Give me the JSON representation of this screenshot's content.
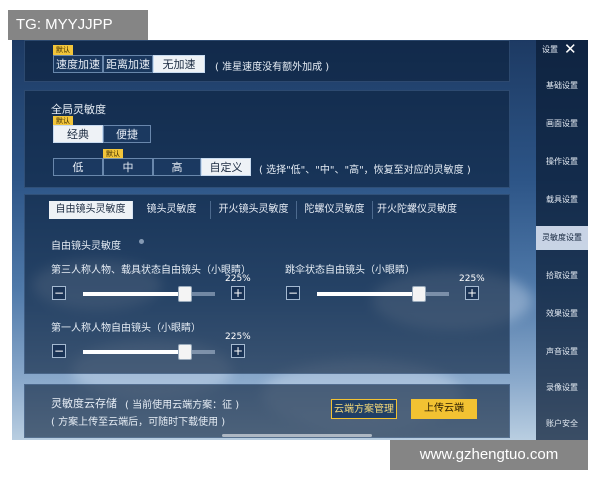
{
  "overlay": {
    "tag": "TG: MYYJJPP",
    "watermark": "www.gzhengtuo.com"
  },
  "speed_panel": {
    "badge": "默认",
    "options": [
      "速度加速",
      "距离加速",
      "无加速"
    ],
    "selected": "无加速",
    "note": "( 准星速度没有额外加成 )"
  },
  "global_sensitivity": {
    "title": "全局灵敏度",
    "badge_mode": "默认",
    "modes": [
      "经典",
      "便捷"
    ],
    "selected_mode": "经典",
    "badge_level": "默认",
    "levels": [
      "低",
      "中",
      "高",
      "自定义"
    ],
    "selected_level": "自定义",
    "note": "( 选择\"低\"、\"中\"、\"高\"，恢复至对应的灵敏度 )"
  },
  "sensitivity_tabs": {
    "tabs": [
      "自由镜头灵敏度",
      "镜头灵敏度",
      "开火镜头灵敏度",
      "陀螺仪灵敏度",
      "开火陀螺仪灵敏度"
    ],
    "selected": "自由镜头灵敏度"
  },
  "free_camera": {
    "section_title": "自由镜头灵敏度",
    "sliders": [
      {
        "label": "第三人称人物、载具状态自由镜头（小眼睛）",
        "value": "225%",
        "level": 0.77
      },
      {
        "label": "跳伞状态自由镜头（小眼睛）",
        "value": "225%",
        "level": 0.77
      },
      {
        "label": "第一人称人物自由镜头（小眼睛）",
        "value": "225%",
        "level": 0.77
      }
    ],
    "minus": "−",
    "plus": "+"
  },
  "cloud_storage": {
    "title": "灵敏度云存储",
    "current_scheme": "( 当前使用云端方案：征 )",
    "hint": "( 方案上传至云端后，可随时下载使用 )",
    "manage_button": "云端方案管理",
    "upload_button": "上传云端"
  },
  "sidebar": {
    "header": "设置",
    "close": "✕",
    "items": [
      "基础设置",
      "画面设置",
      "操作设置",
      "载具设置",
      "灵敏度设置",
      "拾取设置",
      "效果设置",
      "声音设置",
      "录像设置",
      "账户安全"
    ],
    "selected": "灵敏度设置"
  },
  "colors": {
    "accent_yellow": "#f2c53a",
    "selected_white": "#eef2f6",
    "upload_button": "#f2c232"
  }
}
